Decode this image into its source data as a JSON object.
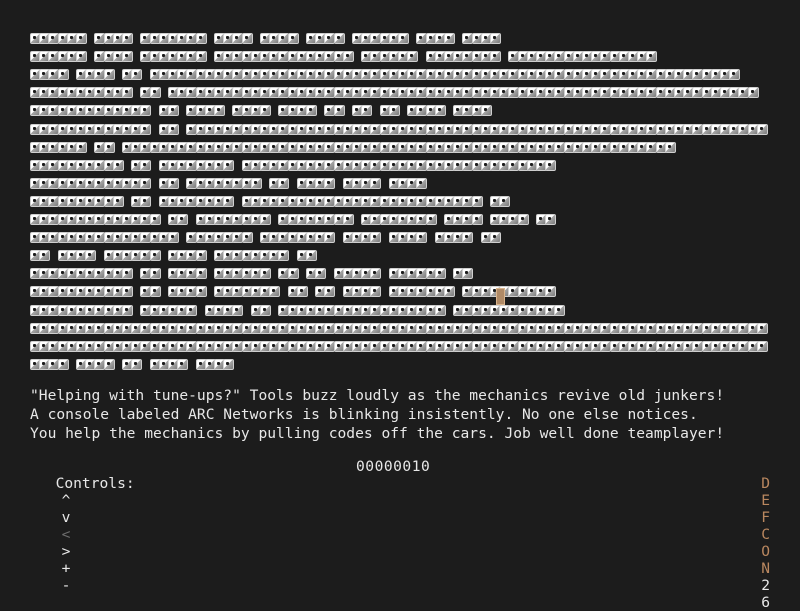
{
  "game": {
    "map_rows": [
      "###### #### ####### #### #### #### ###### #### ####",
      "###### #### ####### ############### ###### ######## ################",
      "#### #### ## ################################################################",
      "########### ## ################################################################",
      "############# ## #### #### #### ## ## ## #### ####",
      "############# ## ###############################################################",
      "###### ## ############################################################",
      "########## ## ######## ##################################",
      "############# ## ######## ## #### #### ####",
      "########## ## ######## ########################## ##",
      "############## ## ######## ######## ######## #### #### ##",
      "################ ####### ######## #### #### #### ##",
      "## #### ###### #### ######## ##",
      "########### ## #### ###### ## ## ##### ###### ##",
      "########### ## #### ####### ## ## #### ####### ##########",
      "########### ###### #### ## ################## ############",
      "##########################################################################################",
      "##########################################################################################",
      "#### #### ## #### ####"
    ],
    "player_tile": "player"
  },
  "messages": [
    "\"Helping with tune-ups?\" Tools buzz loudly as the mechanics revive old junkers!",
    "A console labeled ARC Networks is blinking insistently. No one else notices.",
    "You help the mechanics by pulling codes off the cars. Job well done teamplayer!"
  ],
  "controls": {
    "label": "Controls:",
    "up": "^",
    "down": "v",
    "left": "<",
    "right": ">",
    "plus": "+",
    "minus": "-"
  },
  "score": "00000010",
  "brand": {
    "letters": [
      "D",
      "E",
      "F",
      "C",
      "O",
      "N",
      "2",
      "6"
    ],
    "accent_color": "#b9875f"
  }
}
